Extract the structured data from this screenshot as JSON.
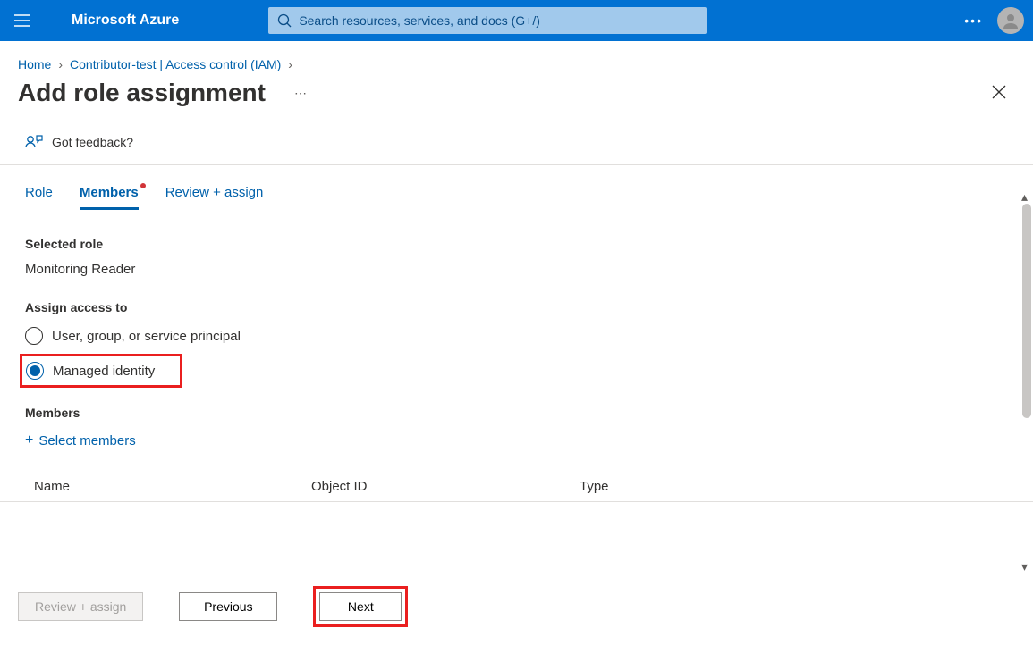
{
  "header": {
    "brand": "Microsoft Azure",
    "search_placeholder": "Search resources, services, and docs (G+/)"
  },
  "breadcrumb": {
    "items": [
      "Home",
      "Contributor-test | Access control (IAM)"
    ]
  },
  "page": {
    "title": "Add role assignment",
    "feedback_label": "Got feedback?"
  },
  "tabs": {
    "items": [
      "Role",
      "Members",
      "Review + assign"
    ],
    "active_index": 1
  },
  "form": {
    "selected_role_label": "Selected role",
    "selected_role_value": "Monitoring Reader",
    "assign_access_label": "Assign access to",
    "radio_options": [
      {
        "label": "User, group, or service principal",
        "selected": false
      },
      {
        "label": "Managed identity",
        "selected": true
      }
    ],
    "members_label": "Members",
    "select_members_label": "Select members"
  },
  "table": {
    "columns": [
      "Name",
      "Object ID",
      "Type"
    ]
  },
  "footer": {
    "review_assign": "Review + assign",
    "previous": "Previous",
    "next": "Next"
  }
}
